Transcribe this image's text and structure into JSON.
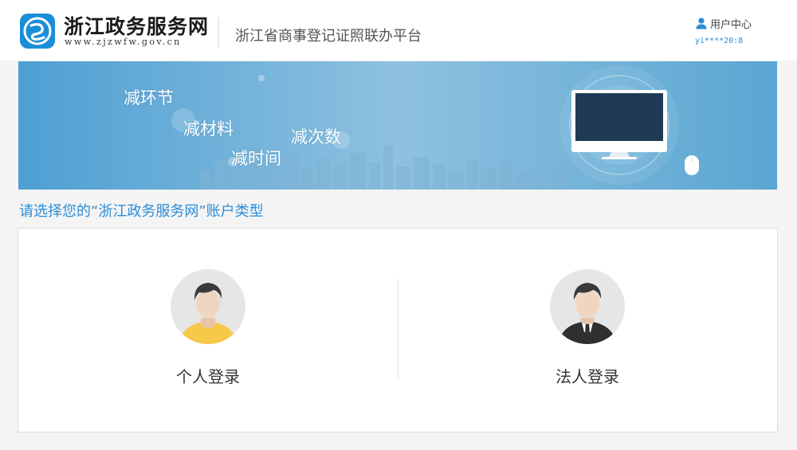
{
  "header": {
    "site_name": "浙江政务服务网",
    "site_url": "www.zjzwfw.gov.cn",
    "platform_title": "浙江省商事登记证照联办平台",
    "user_center_label": "用户中心",
    "username": "yi****20:8"
  },
  "banner": {
    "slogans": [
      "减环节",
      "减材料",
      "减次数",
      "减时间"
    ]
  },
  "prompt": "请选择您的“浙江政务服务网”账户类型",
  "login_options": [
    {
      "label": "个人登录",
      "icon": "personal-avatar-icon"
    },
    {
      "label": "法人登录",
      "icon": "legal-person-avatar-icon"
    }
  ],
  "colors": {
    "accent": "#2b8ed6",
    "banner_blue": "#5aa6d2",
    "personal_shirt": "#f7c948",
    "suit": "#2f2f2f"
  }
}
